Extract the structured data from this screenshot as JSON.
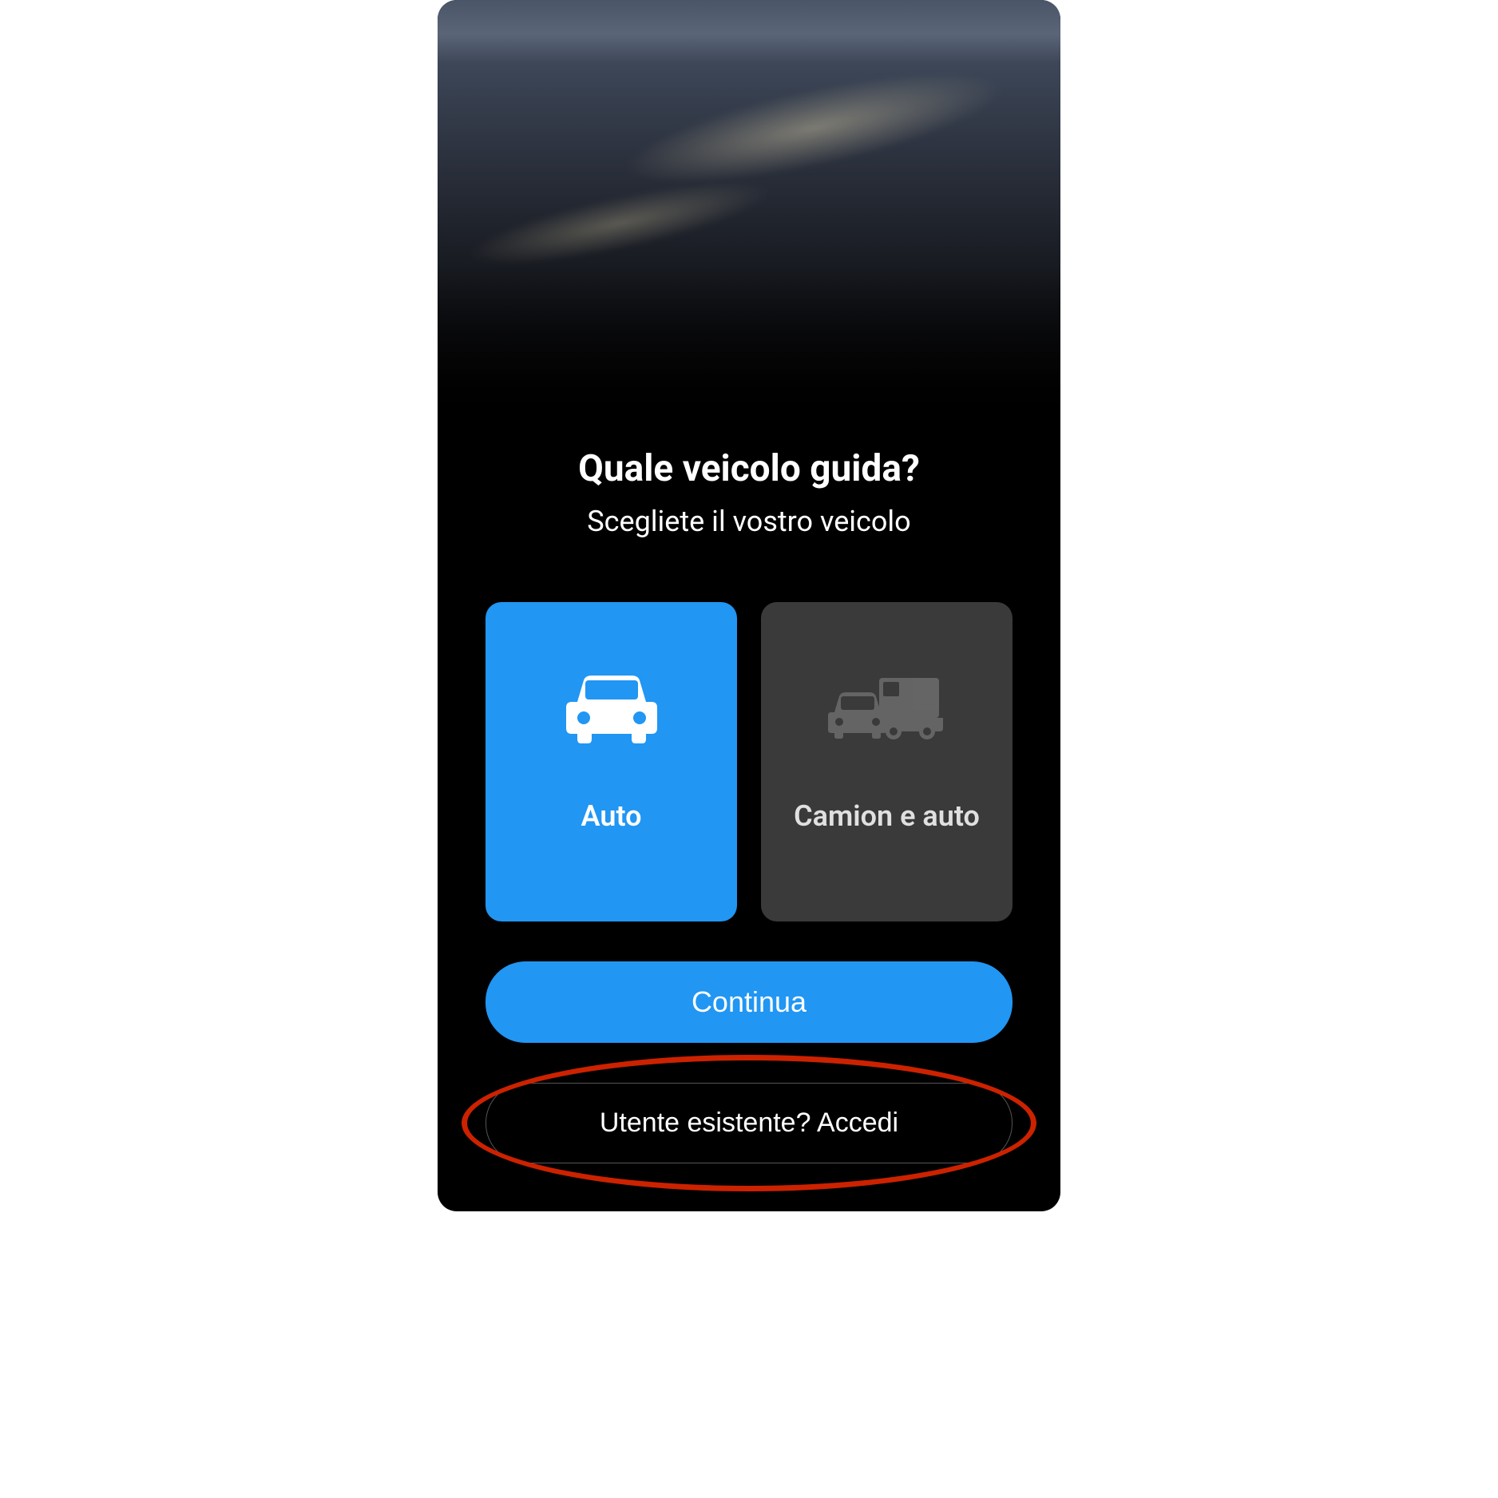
{
  "header": {
    "title": "Quale veicolo guida?",
    "subtitle": "Scegliete il vostro veicolo"
  },
  "options": [
    {
      "id": "auto",
      "label": "Auto",
      "icon": "car-icon",
      "selected": true
    },
    {
      "id": "truck",
      "label": "Camion e auto",
      "icon": "truck-car-icon",
      "selected": false
    }
  ],
  "buttons": {
    "continue": "Continua",
    "signin": "Utente esistente? Accedi"
  },
  "colors": {
    "accent": "#2196f3",
    "background": "#000000",
    "card_unselected": "#3a3a3a",
    "annotation": "#cc2200"
  }
}
